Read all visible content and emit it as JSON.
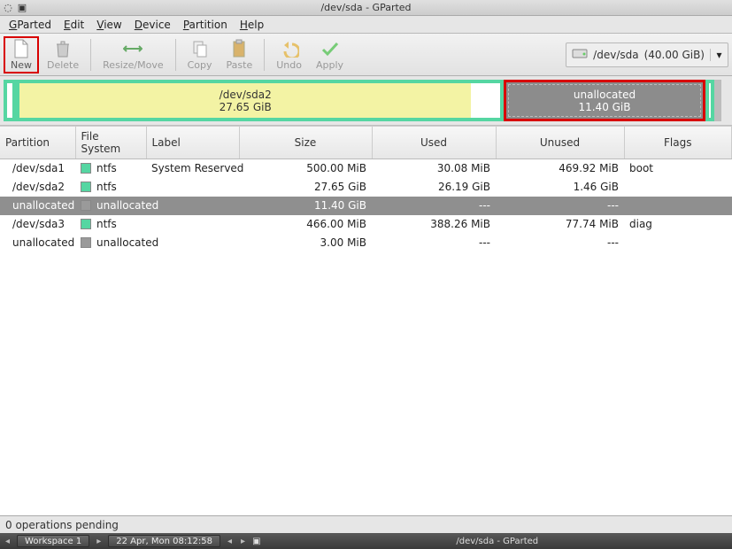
{
  "window": {
    "title": "/dev/sda - GParted"
  },
  "menu": {
    "gparted": "GParted",
    "edit": "Edit",
    "view": "View",
    "device": "Device",
    "partition": "Partition",
    "help": "Help"
  },
  "toolbar": {
    "new": "New",
    "delete": "Delete",
    "resize_move": "Resize/Move",
    "copy": "Copy",
    "paste": "Paste",
    "undo": "Undo",
    "apply": "Apply"
  },
  "device_selector": {
    "device": "/dev/sda",
    "size": "(40.00 GiB)"
  },
  "partbar": {
    "sda2_name": "/dev/sda2",
    "sda2_size": "27.65 GiB",
    "unalloc_name": "unallocated",
    "unalloc_size": "11.40 GiB"
  },
  "table": {
    "headers": {
      "partition": "Partition",
      "filesystem": "File System",
      "label": "Label",
      "size": "Size",
      "used": "Used",
      "unused": "Unused",
      "flags": "Flags"
    },
    "rows": [
      {
        "partition": "/dev/sda1",
        "fs_class": "fs-ntfs",
        "filesystem": "ntfs",
        "label": "System Reserved",
        "size": "500.00 MiB",
        "used": "30.08 MiB",
        "unused": "469.92 MiB",
        "flags": "boot",
        "selected": false
      },
      {
        "partition": "/dev/sda2",
        "fs_class": "fs-ntfs",
        "filesystem": "ntfs",
        "label": "",
        "size": "27.65 GiB",
        "used": "26.19 GiB",
        "unused": "1.46 GiB",
        "flags": "",
        "selected": false
      },
      {
        "partition": "unallocated",
        "fs_class": "fs-unalloc",
        "filesystem": "unallocated",
        "label": "",
        "size": "11.40 GiB",
        "used": "---",
        "unused": "---",
        "flags": "",
        "selected": true
      },
      {
        "partition": "/dev/sda3",
        "fs_class": "fs-ntfs",
        "filesystem": "ntfs",
        "label": "",
        "size": "466.00 MiB",
        "used": "388.26 MiB",
        "unused": "77.74 MiB",
        "flags": "diag",
        "selected": false
      },
      {
        "partition": "unallocated",
        "fs_class": "fs-unalloc",
        "filesystem": "unallocated",
        "label": "",
        "size": "3.00 MiB",
        "used": "---",
        "unused": "---",
        "flags": "",
        "selected": false
      }
    ]
  },
  "statusbar": {
    "text": "0 operations pending"
  },
  "taskbar": {
    "workspace": "Workspace 1",
    "clock": "22 Apr, Mon 08:12:58",
    "window_title": "/dev/sda - GParted"
  }
}
